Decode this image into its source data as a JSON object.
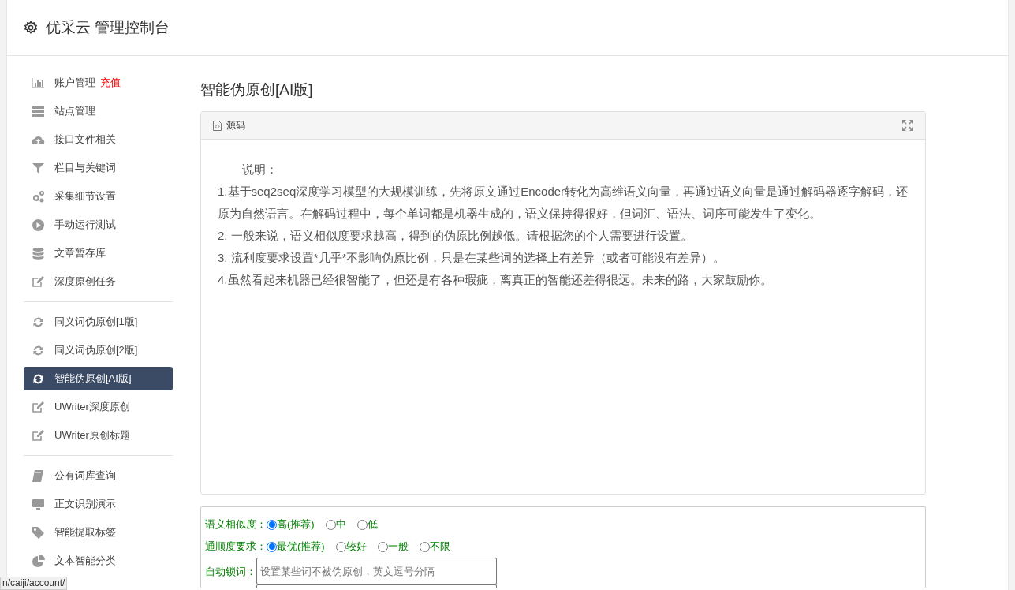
{
  "header": {
    "title": "优采云 管理控制台"
  },
  "sidebar": {
    "groups": [
      [
        {
          "label": "账户管理",
          "badge": "充值",
          "selected": false
        },
        {
          "label": "站点管理",
          "selected": false
        },
        {
          "label": "接口文件相关",
          "selected": false
        },
        {
          "label": "栏目与关键词",
          "selected": false
        },
        {
          "label": "采集细节设置",
          "selected": false
        },
        {
          "label": "手动运行测试",
          "selected": false
        },
        {
          "label": "文章暂存库",
          "selected": false
        },
        {
          "label": "深度原创任务",
          "selected": false
        }
      ],
      [
        {
          "label": "同义词伪原创[1版]",
          "selected": false
        },
        {
          "label": "同义词伪原创[2版]",
          "selected": false
        },
        {
          "label": "智能伪原创[AI版]",
          "selected": true
        },
        {
          "label": "UWriter深度原创",
          "selected": false
        },
        {
          "label": "UWriter原创标题",
          "selected": false
        }
      ],
      [
        {
          "label": "公有词库查询",
          "selected": false
        },
        {
          "label": "正文识别演示",
          "selected": false
        },
        {
          "label": "智能提取标签",
          "selected": false
        },
        {
          "label": "文本智能分类",
          "selected": false
        }
      ]
    ]
  },
  "content": {
    "title": "智能伪原创[AI版]",
    "editor": {
      "tab": "源码",
      "lines": [
        "说明：",
        "1.基于seq2seq深度学习模型的大规模训练，先将原文通过Encoder转化为高维语义向量，再通过语义向量是通过解码器逐字解码，还原为自然语言。在解码过程中，每个单词都是机器生成的，语义保持得很好，但词汇、语法、词序可能发生了变化。",
        "2. 一般来说，语义相似度要求越高，得到的伪原比例越低。请根据您的个人需要进行设置。",
        "3. 流利度要求设置*几乎*不影响伪原比例，只是在某些词的选择上有差异（或者可能没有差异）。",
        "4.虽然看起来机器已经很智能了，但还是有各种瑕疵，离真正的智能还差得很远。未来的路，大家鼓励你。"
      ]
    },
    "form": {
      "radio_groups": [
        {
          "label": "语义相似度：",
          "options": [
            {
              "label": "高(推荐)",
              "selected": true
            },
            {
              "label": "中",
              "selected": false
            },
            {
              "label": "低",
              "selected": false
            }
          ]
        },
        {
          "label": "通顺度要求：",
          "options": [
            {
              "label": "最优(推荐)",
              "selected": true
            },
            {
              "label": "较好",
              "selected": false
            },
            {
              "label": "一般",
              "selected": false
            },
            {
              "label": "不限",
              "selected": false
            }
          ]
        }
      ],
      "lock_words": {
        "label": "自动锁词：",
        "placeholder": "设置某些词不被伪原创，英文逗号分隔"
      }
    }
  },
  "status_bar": {
    "url": "n/caiji/account/"
  }
}
